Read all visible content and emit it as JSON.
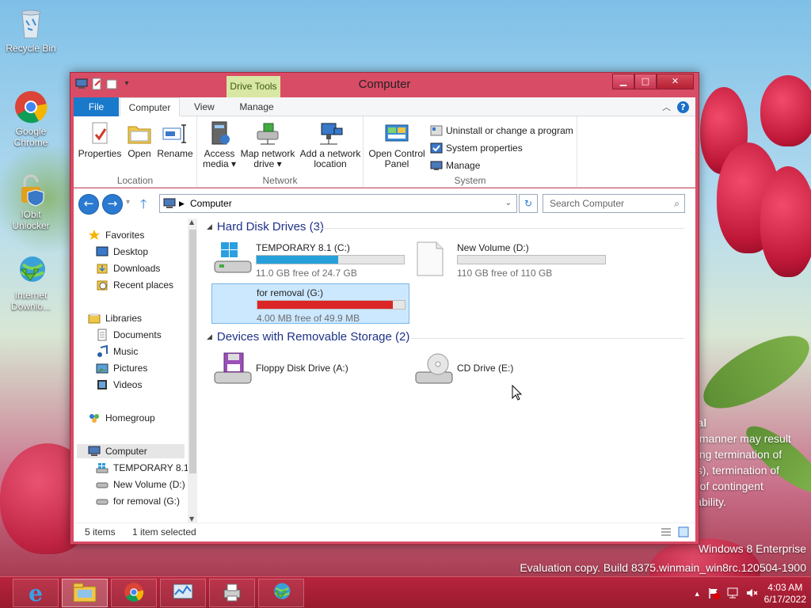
{
  "desktop": {
    "icons": [
      {
        "label": "Recycle Bin"
      },
      {
        "label": "Google Chrome"
      },
      {
        "label": "IObit Unlocker"
      },
      {
        "label": "Internet Downlo..."
      }
    ],
    "watermark": {
      "edition": "Windows 8 Enterprise",
      "build": "Evaluation copy. Build 8375.winmain_win8rc.120504-1900"
    },
    "legal_fragment": {
      "line1": "tial",
      "line2": "y manner may result",
      "line3": "ding termination of",
      "line4": "es), termination of",
      "line5": "e of contingent",
      "line6": "liability."
    }
  },
  "window": {
    "title": "Computer",
    "contextual_tab": "Drive Tools",
    "tabs": {
      "file": "File",
      "computer": "Computer",
      "view": "View",
      "manage": "Manage"
    },
    "ribbon": {
      "location": {
        "label": "Location",
        "buttons": [
          {
            "label": "Properties"
          },
          {
            "label": "Open"
          },
          {
            "label": "Rename"
          }
        ]
      },
      "network": {
        "label": "Network",
        "access_media_1": "Access",
        "access_media_2": "media ▾",
        "map_drive_1": "Map network",
        "map_drive_2": "drive ▾",
        "add_location_1": "Add a network",
        "add_location_2": "location"
      },
      "system": {
        "label": "System",
        "open_cp_1": "Open Control",
        "open_cp_2": "Panel",
        "uninstall": "Uninstall or change a program",
        "sys_props": "System properties",
        "manage": "Manage"
      }
    },
    "address": {
      "path": "Computer",
      "search_placeholder": "Search Computer"
    },
    "nav": {
      "favorites": "Favorites",
      "desktop": "Desktop",
      "downloads": "Downloads",
      "recent": "Recent places",
      "libraries": "Libraries",
      "documents": "Documents",
      "music": "Music",
      "pictures": "Pictures",
      "videos": "Videos",
      "homegroup": "Homegroup",
      "computer": "Computer",
      "drive_c": "TEMPORARY 8.1",
      "drive_d": "New Volume (D:)",
      "drive_g": "for removal (G:)"
    },
    "sections": {
      "hdd": "Hard Disk Drives (3)",
      "removable": "Devices with Removable Storage (2)"
    },
    "drives": {
      "c": {
        "name": "TEMPORARY 8.1 (C:)",
        "free": "11.0 GB free of 24.7 GB",
        "used_fraction": 0.555,
        "color": "#26a0da"
      },
      "d": {
        "name": "New Volume (D:)",
        "free": "110 GB free of 110 GB",
        "used_fraction": 0.0,
        "color": "#26a0da"
      },
      "g": {
        "name": "for removal (G:)",
        "free": "4.00 MB free of 49.9 MB",
        "used_fraction": 0.92,
        "color": "#da2626"
      },
      "a": {
        "name": "Floppy Disk Drive (A:)"
      },
      "e": {
        "name": "CD Drive (E:)"
      }
    },
    "status": {
      "items": "5 items",
      "selected": "1 item selected"
    }
  },
  "taskbar": {
    "time": "4:03 AM",
    "date": "6/17/2022"
  }
}
